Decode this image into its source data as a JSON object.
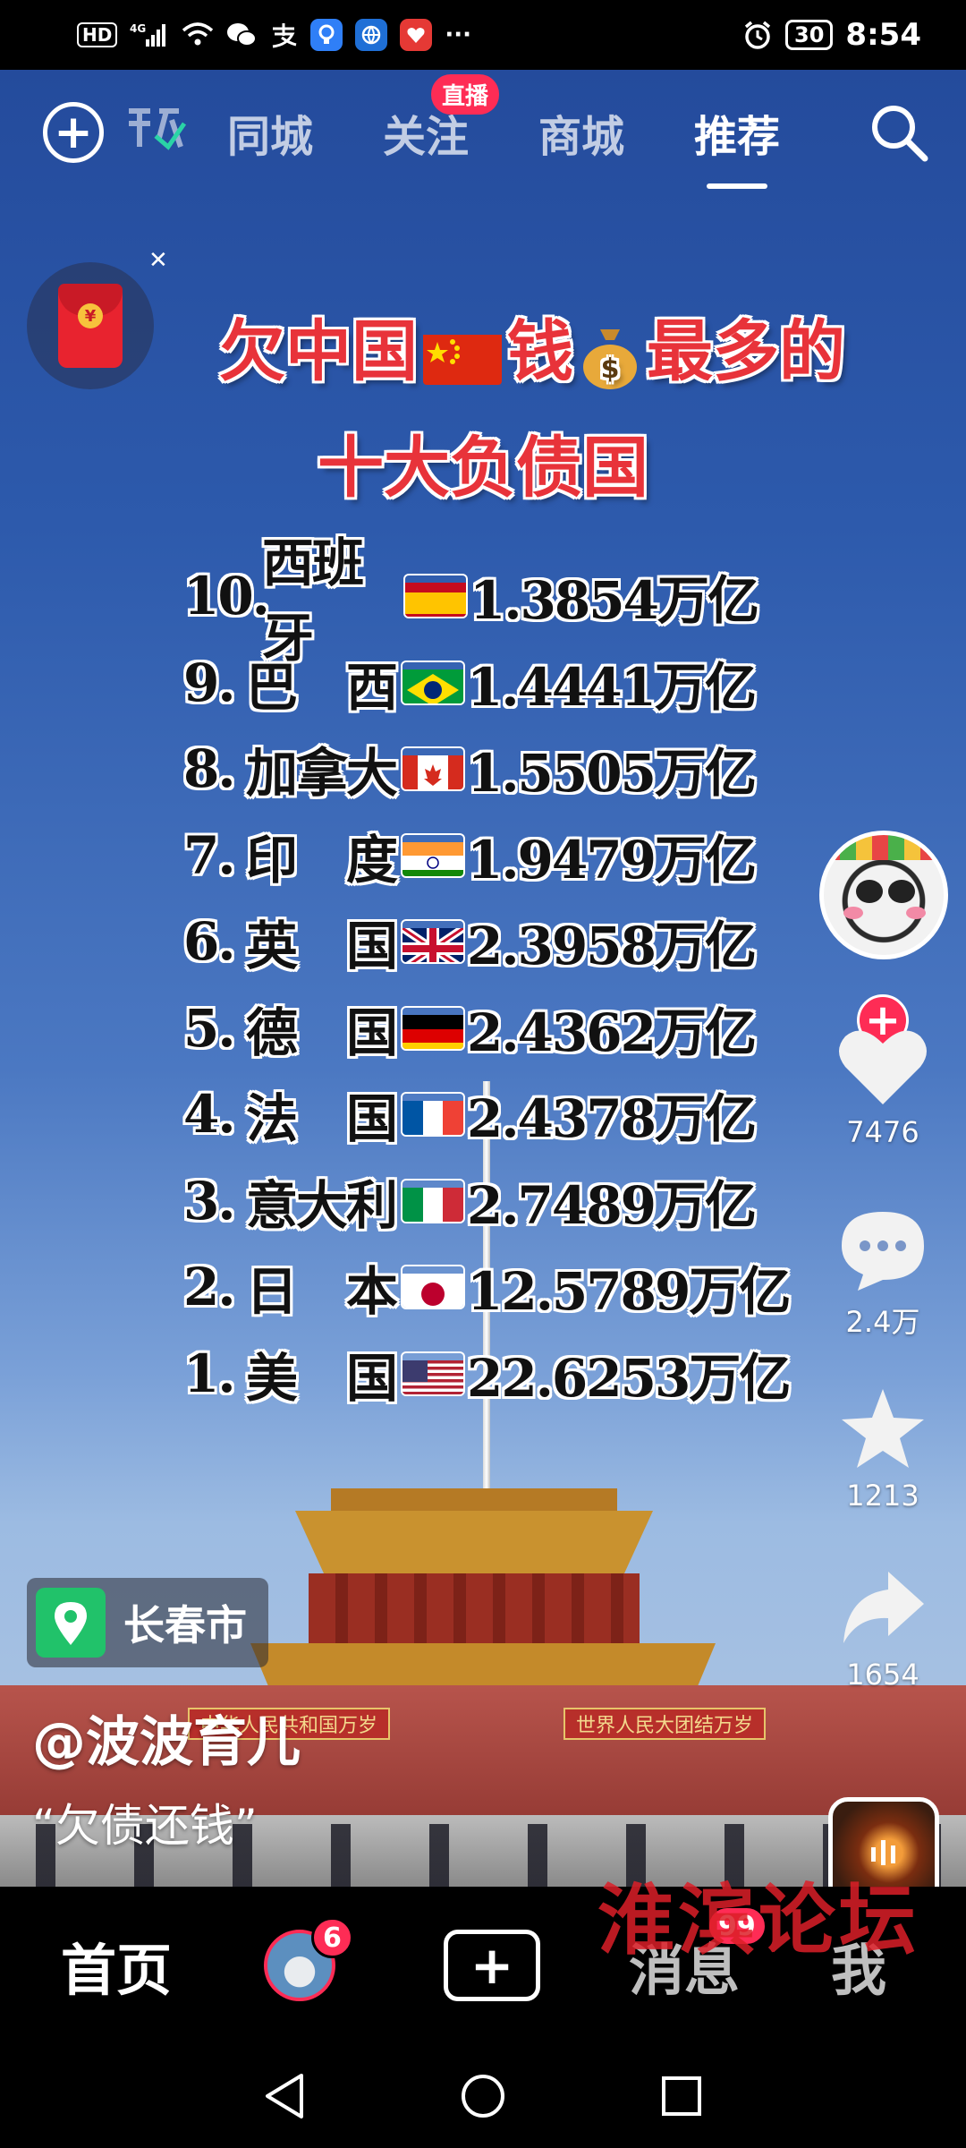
{
  "status_bar": {
    "left_icons": [
      "hd-icon",
      "signal-4g-icon",
      "wifi-icon",
      "wechat-icon",
      "alipay-icon",
      "app-icon-blue",
      "app-icon-globe",
      "app-icon-red",
      "more-icon"
    ],
    "hd": "HD",
    "net": "4G",
    "more": "···",
    "battery": "30",
    "time": "8:54"
  },
  "top_nav": {
    "tabs": [
      {
        "label": "同城",
        "active": false
      },
      {
        "label": "关注",
        "active": false,
        "badge": "直播"
      },
      {
        "label": "商城",
        "active": false
      },
      {
        "label": "推荐",
        "active": true
      }
    ]
  },
  "headline": {
    "line1_a": "欠中国",
    "line1_b": "钱",
    "line1_c": "最多的",
    "line2": "十大负债国"
  },
  "rankings": [
    {
      "rank": "10.",
      "country": "西班牙",
      "flag": "es-flag",
      "amount": "1.3854万亿"
    },
    {
      "rank": "9.",
      "country": "巴　西",
      "flag": "br-flag",
      "amount": "1.4441万亿"
    },
    {
      "rank": "8.",
      "country": "加拿大",
      "flag": "ca-flag",
      "amount": "1.5505万亿"
    },
    {
      "rank": "7.",
      "country": "印　度",
      "flag": "in-flag",
      "amount": "1.9479万亿"
    },
    {
      "rank": "6.",
      "country": "英　国",
      "flag": "gb-flag",
      "amount": "2.3958万亿"
    },
    {
      "rank": "5.",
      "country": "德　国",
      "flag": "de-flag",
      "amount": "2.4362万亿"
    },
    {
      "rank": "4.",
      "country": "法　国",
      "flag": "fr-flag",
      "amount": "2.4378万亿"
    },
    {
      "rank": "3.",
      "country": "意大利",
      "flag": "it-flag",
      "amount": "2.7489万亿"
    },
    {
      "rank": "2.",
      "country": "日　本",
      "flag": "jp-flag",
      "amount": "12.5789万亿"
    },
    {
      "rank": "1.",
      "country": "美　国",
      "flag": "us-flag",
      "amount": "22.6253万亿"
    }
  ],
  "scene": {
    "wall_sign_left": "中华人民共和国万岁",
    "wall_sign_right": "世界人民大团结万岁"
  },
  "location": {
    "label": "长春市"
  },
  "author": "@波波育儿",
  "caption": "“欠债还钱”",
  "actions": {
    "likes": "7476",
    "comments": "2.4万",
    "favorites": "1213",
    "shares": "1654"
  },
  "tab_bar": {
    "home": "首页",
    "friends_badge": "6",
    "messages": "消息",
    "messages_badge": "99",
    "me": "我"
  },
  "watermark": "淮滨论坛",
  "colors": {
    "accent": "#fe2c55",
    "title_red": "#e8333a",
    "location_green": "#21c26a"
  }
}
